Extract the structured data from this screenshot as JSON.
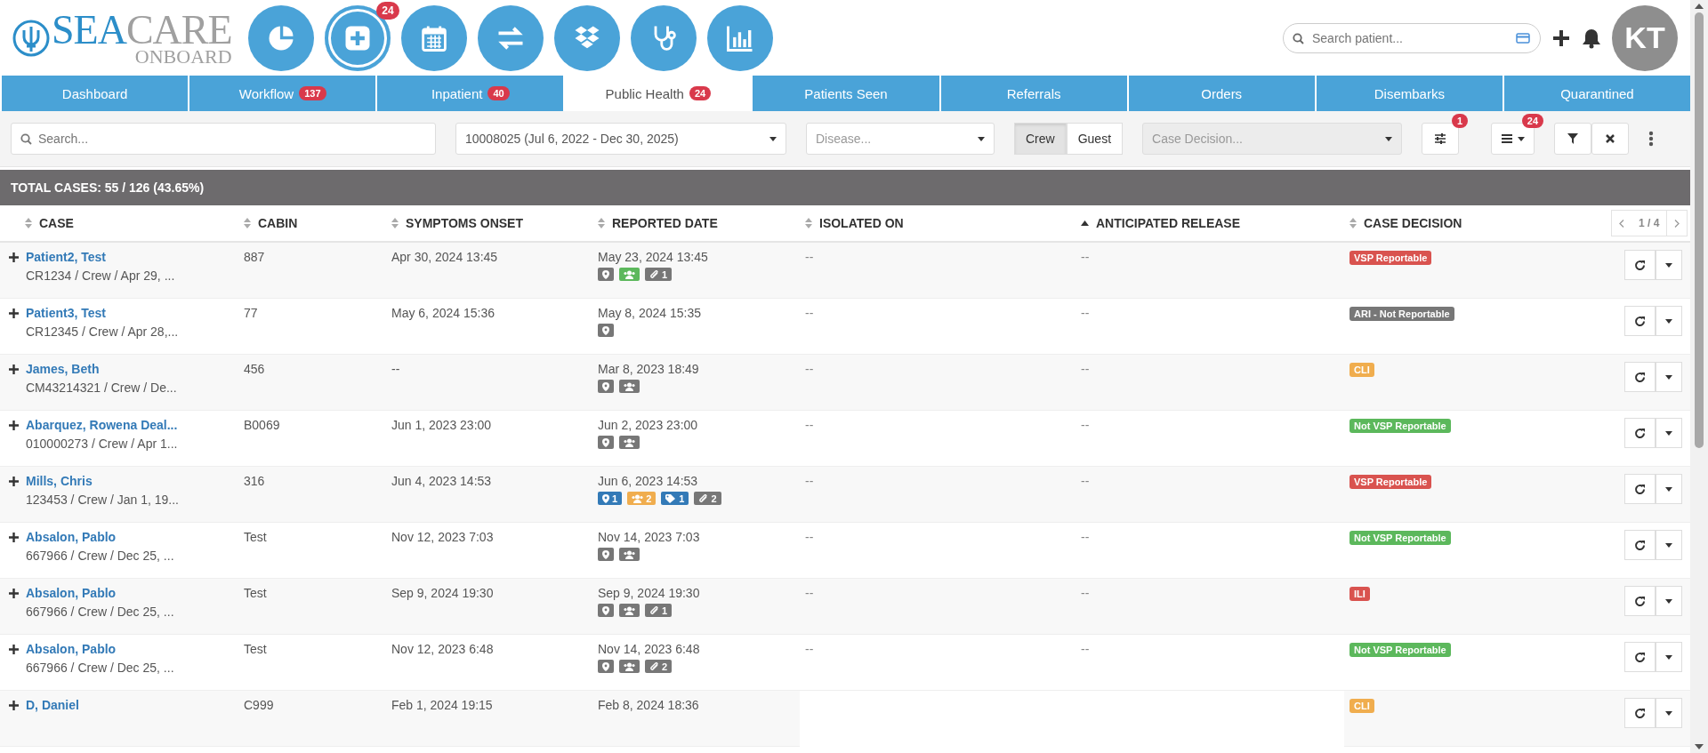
{
  "logo": {
    "word_1": "SEA",
    "word_2": "CARE",
    "subtitle": "ONBOARD"
  },
  "toolbar_icons": [
    {
      "kind": "pie",
      "selected": false
    },
    {
      "kind": "add",
      "selected": true,
      "badge": "24"
    },
    {
      "kind": "calendar",
      "selected": false
    },
    {
      "kind": "transfer",
      "selected": false
    },
    {
      "kind": "boxes",
      "selected": false
    },
    {
      "kind": "stethoscope",
      "selected": false
    },
    {
      "kind": "bars",
      "selected": false
    }
  ],
  "patient_search": {
    "placeholder": "Search patient..."
  },
  "avatar": {
    "initials": "KT"
  },
  "tabs": [
    {
      "label": "Dashboard",
      "selected": false
    },
    {
      "label": "Workflow",
      "badge": "137",
      "selected": false
    },
    {
      "label": "Inpatient",
      "badge": "40",
      "selected": false
    },
    {
      "label": "Public Health",
      "badge": "24",
      "selected": true
    },
    {
      "label": "Patients Seen",
      "selected": false
    },
    {
      "label": "Referrals",
      "selected": false
    },
    {
      "label": "Orders",
      "selected": false
    },
    {
      "label": "Disembarks",
      "selected": false
    },
    {
      "label": "Quarantined",
      "selected": false
    }
  ],
  "filters": {
    "search": {
      "placeholder": "Search..."
    },
    "voyage": {
      "value": "10008025 (Jul 6, 2022 - Dec 30, 2025)"
    },
    "disease": {
      "placeholder": "Disease..."
    },
    "segments": [
      {
        "label": "Crew",
        "selected": true
      },
      {
        "label": "Guest",
        "selected": false
      }
    ],
    "case_decision": {
      "placeholder": "Case Decision...",
      "disabled": true
    },
    "settings_badge": "1",
    "columns_badge": "24"
  },
  "summary": "TOTAL CASES: 55 / 126 (43.65%)",
  "table": {
    "columns": [
      {
        "label": "CASE",
        "sorted": false
      },
      {
        "label": "CABIN",
        "sorted": false
      },
      {
        "label": "SYMPTOMS ONSET",
        "sorted": false
      },
      {
        "label": "REPORTED DATE",
        "sorted": false
      },
      {
        "label": "ISOLATED ON",
        "sorted": false
      },
      {
        "label": "ANTICIPATED RELEASE",
        "sorted": true
      },
      {
        "label": "CASE DECISION",
        "sorted": false
      }
    ],
    "pagination": "1 / 4",
    "rows": [
      {
        "name": "Patient2, Test",
        "details": "CR1234 / Crew / Apr 29, ...",
        "cabin": "887",
        "symptoms_onset": "Apr 30, 2024 13:45",
        "reported_date": "May 23, 2024 13:45",
        "indicators": [
          {
            "kind": "location",
            "color": "#777777"
          },
          {
            "kind": "group",
            "color": "#5cb85c"
          },
          {
            "kind": "attachment",
            "color": "#777777",
            "count": "1"
          }
        ],
        "isolated_on": "--",
        "anticipated_release": "--",
        "decision": {
          "label": "VSP Reportable",
          "color": "#d9534f"
        }
      },
      {
        "name": "Patient3, Test",
        "details": "CR12345 / Crew / Apr 28,...",
        "cabin": "77",
        "symptoms_onset": "May 6, 2024 15:36",
        "reported_date": "May 8, 2024 15:35",
        "indicators": [
          {
            "kind": "location",
            "color": "#777777"
          }
        ],
        "isolated_on": "--",
        "anticipated_release": "--",
        "decision": {
          "label": "ARI - Not Reportable",
          "color": "#777777"
        }
      },
      {
        "name": "James, Beth",
        "details": "CM43214321 / Crew / De...",
        "cabin": "456",
        "symptoms_onset": "--",
        "reported_date": "Mar 8, 2023 18:49",
        "indicators": [
          {
            "kind": "location",
            "color": "#777777"
          },
          {
            "kind": "group",
            "color": "#777777"
          }
        ],
        "isolated_on": "--",
        "anticipated_release": "--",
        "decision": {
          "label": "CLI",
          "color": "#f0ad4e"
        }
      },
      {
        "name": "Abarquez, Rowena Deal...",
        "details": "010000273 / Crew / Apr 1...",
        "cabin": "B0069",
        "symptoms_onset": "Jun 1, 2023 23:00",
        "reported_date": "Jun 2, 2023 23:00",
        "indicators": [
          {
            "kind": "location",
            "color": "#777777"
          },
          {
            "kind": "group",
            "color": "#777777"
          }
        ],
        "isolated_on": "--",
        "anticipated_release": "--",
        "decision": {
          "label": "Not VSP Reportable",
          "color": "#5cb85c"
        }
      },
      {
        "name": "Mills, Chris",
        "details": "123453 / Crew / Jan 1, 19...",
        "cabin": "316",
        "symptoms_onset": "Jun 4, 2023 14:53",
        "reported_date": "Jun 6, 2023 14:53",
        "indicators": [
          {
            "kind": "location",
            "color": "#337ab7",
            "count": "1"
          },
          {
            "kind": "group",
            "color": "#f0ad4e",
            "count": "2"
          },
          {
            "kind": "tag",
            "color": "#337ab7",
            "count": "1"
          },
          {
            "kind": "attachment",
            "color": "#777777",
            "count": "2"
          }
        ],
        "isolated_on": "--",
        "anticipated_release": "--",
        "decision": {
          "label": "VSP Reportable",
          "color": "#d9534f"
        }
      },
      {
        "name": "Absalon, Pablo",
        "details": "667966 / Crew / Dec 25, ...",
        "cabin": "Test",
        "symptoms_onset": "Nov 12, 2023 7:03",
        "reported_date": "Nov 14, 2023 7:03",
        "indicators": [
          {
            "kind": "location",
            "color": "#777777"
          },
          {
            "kind": "group",
            "color": "#777777"
          }
        ],
        "isolated_on": "--",
        "anticipated_release": "--",
        "decision": {
          "label": "Not VSP Reportable",
          "color": "#5cb85c"
        }
      },
      {
        "name": "Absalon, Pablo",
        "details": "667966 / Crew / Dec 25, ...",
        "cabin": "Test",
        "symptoms_onset": "Sep 9, 2024 19:30",
        "reported_date": "Sep 9, 2024 19:30",
        "indicators": [
          {
            "kind": "location",
            "color": "#777777"
          },
          {
            "kind": "group",
            "color": "#777777"
          },
          {
            "kind": "attachment",
            "color": "#777777",
            "count": "1"
          }
        ],
        "isolated_on": "--",
        "anticipated_release": "--",
        "decision": {
          "label": "ILI",
          "color": "#d9534f"
        }
      },
      {
        "name": "Absalon, Pablo",
        "details": "667966 / Crew / Dec 25, ...",
        "cabin": "Test",
        "symptoms_onset": "Nov 12, 2023 6:48",
        "reported_date": "Nov 14, 2023 6:48",
        "indicators": [
          {
            "kind": "location",
            "color": "#777777"
          },
          {
            "kind": "group",
            "color": "#777777"
          },
          {
            "kind": "attachment",
            "color": "#777777",
            "count": "2"
          }
        ],
        "isolated_on": "--",
        "anticipated_release": "--",
        "decision": {
          "label": "Not VSP Reportable",
          "color": "#5cb85c"
        }
      },
      {
        "name": "D, Daniel",
        "cabin": "C999",
        "symptoms_onset": "Feb 1, 2024 19:15",
        "reported_date": "Feb 8, 2024 18:36",
        "decision": {
          "label": "CLI",
          "color": "#f0ad4e"
        }
      }
    ]
  }
}
